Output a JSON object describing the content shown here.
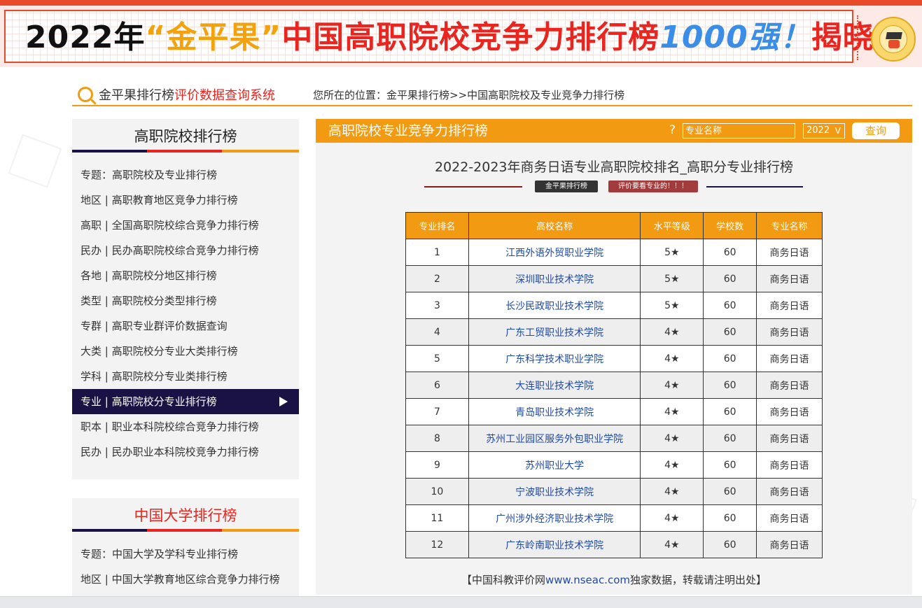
{
  "banner": {
    "part1": "2022年",
    "part2": "“金平果”",
    "part3": "中国高职院校竞争力排行榜",
    "part4": "1000强！",
    "part5": "揭晓"
  },
  "site": {
    "name": "金平果排行榜",
    "system": "评价数据查询系统"
  },
  "breadcrumb": "您所在的位置：金平果排行榜>>中国高职院校及专业竞争力排行榜",
  "sidebar": {
    "title": "高职院校排行榜",
    "items": [
      "专题：高职院校及专业排行榜",
      "地区 | 高职教育地区竞争力排行榜",
      "高职 | 全国高职院校综合竞争力排行榜",
      "民办 | 民办高职院校综合竞争力排行榜",
      "各地 | 高职院校分地区排行榜",
      "类型 | 高职院校分类型排行榜",
      "专群 | 高职专业群评价数据查询",
      "大类 | 高职院校分专业大类排行榜",
      "学科 | 高职院校分专业类排行榜",
      "专业 | 高职院校分专业排行榜",
      "职本 | 职业本科院校综合竞争力排行榜",
      "民办 | 民办职业本科院校竞争力排行榜"
    ],
    "active_index": 9
  },
  "sidebar2": {
    "title": "中国大学排行榜",
    "items": [
      "专题：中国大学及学科专业排行榜",
      "地区 | 中国大学教育地区综合竞争力排行榜"
    ]
  },
  "main": {
    "header_title": "高职院校专业竞争力排行榜",
    "help": "?",
    "search_placeholder": "专业名称",
    "year": "2022",
    "year_caret": "V",
    "query_label": "查询",
    "page_title": "2022-2023年商务日语专业高职院校排名_高职分专业排行榜",
    "tag1": "金平果排行榜",
    "tag2": "评价要看专业的！！！",
    "table": {
      "headers": [
        "专业排名",
        "高校名称",
        "水平等级",
        "学校数",
        "专业名称"
      ],
      "rows": [
        [
          "1",
          "江西外语外贸职业学院",
          "5★",
          "60",
          "商务日语"
        ],
        [
          "2",
          "深圳职业技术学院",
          "5★",
          "60",
          "商务日语"
        ],
        [
          "3",
          "长沙民政职业技术学院",
          "5★",
          "60",
          "商务日语"
        ],
        [
          "4",
          "广东工贸职业技术学院",
          "4★",
          "60",
          "商务日语"
        ],
        [
          "5",
          "广东科学技术职业学院",
          "4★",
          "60",
          "商务日语"
        ],
        [
          "6",
          "大连职业技术学院",
          "4★",
          "60",
          "商务日语"
        ],
        [
          "7",
          "青岛职业技术学院",
          "4★",
          "60",
          "商务日语"
        ],
        [
          "8",
          "苏州工业园区服务外包职业学院",
          "4★",
          "60",
          "商务日语"
        ],
        [
          "9",
          "苏州职业大学",
          "4★",
          "60",
          "商务日语"
        ],
        [
          "10",
          "宁波职业技术学院",
          "4★",
          "60",
          "商务日语"
        ],
        [
          "11",
          "广州涉外经济职业技术学院",
          "4★",
          "60",
          "商务日语"
        ],
        [
          "12",
          "广东岭南职业技术学院",
          "4★",
          "60",
          "商务日语"
        ]
      ]
    },
    "footer": {
      "prefix": "【中国科教评价网",
      "link": "www.nseac.com",
      "suffix": "独家数据，转载请注明出处】"
    }
  },
  "colors": {
    "accent": "#f29b12",
    "navy": "#1a1144",
    "red": "#e8251f",
    "link": "#1f4aa8"
  }
}
